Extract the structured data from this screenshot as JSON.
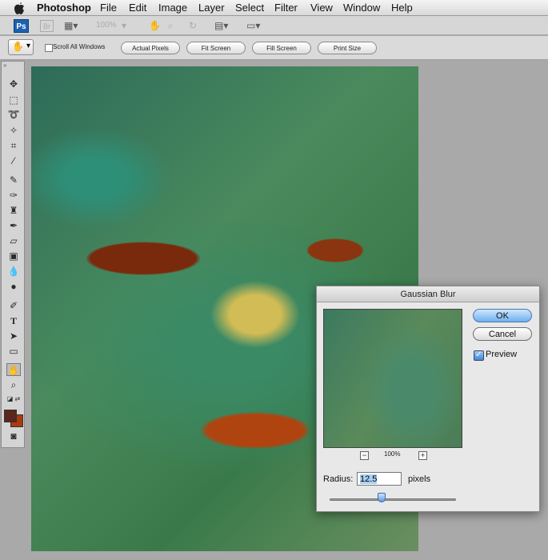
{
  "menubar": {
    "app_name": "Photoshop",
    "items": [
      "File",
      "Edit",
      "Image",
      "Layer",
      "Select",
      "Filter",
      "View",
      "Window",
      "Help"
    ]
  },
  "appbar": {
    "ps_logo": "Ps",
    "br_logo": "Br",
    "zoom": "100%"
  },
  "options": {
    "scroll_all_windows": "Scroll All Windows",
    "buttons": [
      "Actual Pixels",
      "Fit Screen",
      "Fill Screen",
      "Print Size"
    ]
  },
  "toolbox": {
    "tools": [
      "move-icon",
      "marquee-icon",
      "lasso-icon",
      "magic-wand-icon",
      "crop-icon",
      "eyedropper-icon",
      "healing-brush-icon",
      "brush-icon",
      "clone-stamp-icon",
      "history-brush-icon",
      "eraser-icon",
      "gradient-icon",
      "blur-icon",
      "dodge-icon",
      "pen-icon",
      "type-icon",
      "path-selection-icon",
      "shape-icon",
      "hand-icon",
      "zoom-icon"
    ],
    "active_tool": "hand-icon",
    "fg_color": "#5a261d",
    "bg_color": "#aa3b0f"
  },
  "dialog": {
    "title": "Gaussian Blur",
    "ok": "OK",
    "cancel": "Cancel",
    "preview_label": "Preview",
    "preview_checked": true,
    "zoom_minus": "−",
    "zoom_plus": "+",
    "zoom_level": "100%",
    "radius_label": "Radius:",
    "radius_value": "12.5",
    "radius_unit": "pixels"
  }
}
